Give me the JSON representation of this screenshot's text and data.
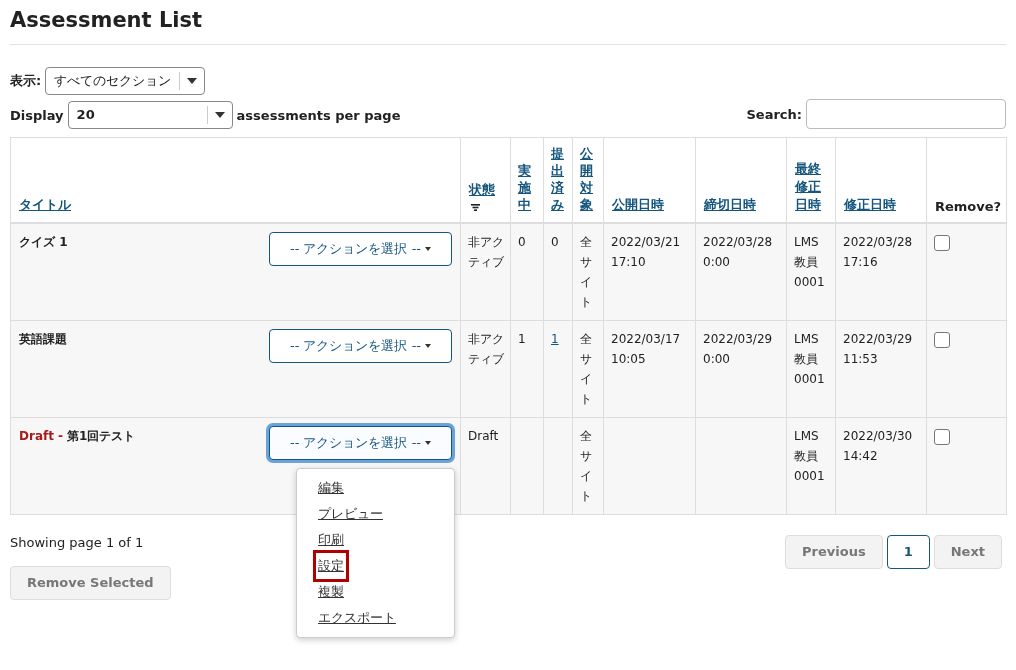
{
  "page_title": "Assessment List",
  "section_filter": {
    "label": "表示:",
    "value": "すべてのセクション"
  },
  "page_size": {
    "label": "Display",
    "value": "20",
    "suffix": "assessments per page"
  },
  "search": {
    "label": "Search:"
  },
  "table": {
    "columns": [
      {
        "label": "タイトル",
        "link": true,
        "vertical": false,
        "sort_icon": false
      },
      {
        "label": "状態",
        "link": true,
        "vertical": false,
        "sort_icon": true
      },
      {
        "label": "実施中",
        "link": true,
        "vertical": true,
        "sort_icon": false
      },
      {
        "label": "提出済み",
        "link": true,
        "vertical": true,
        "sort_icon": false
      },
      {
        "label": "公開対象",
        "link": true,
        "vertical": true,
        "sort_icon": false
      },
      {
        "label": "公開日時",
        "link": true,
        "vertical": false,
        "sort_icon": false
      },
      {
        "label": "締切日時",
        "link": true,
        "vertical": false,
        "sort_icon": false
      },
      {
        "label": "最終修正日時",
        "link": true,
        "vertical": false,
        "sort_icon": false
      },
      {
        "label": "修正日時",
        "link": true,
        "vertical": false,
        "sort_icon": false
      },
      {
        "label": "Remove?",
        "link": false,
        "vertical": false,
        "sort_icon": false
      }
    ],
    "rows": [
      {
        "title": "クイズ 1",
        "action": {
          "label": "-- アクションを選択 --",
          "focused": false,
          "expanded": false
        },
        "status": "非アクティブ",
        "in_progress": "0",
        "submitted": "0",
        "submitted_link": false,
        "audience": "全サイト",
        "release": "2022/03/21 17:10",
        "due": "2022/03/28 0:00",
        "modified_by": "LMS 教員 0001",
        "modified": "2022/03/28 17:16",
        "checked": false
      },
      {
        "title": "英語課題",
        "action": {
          "label": "-- アクションを選択 --",
          "focused": false,
          "expanded": false
        },
        "status": "非アクティブ",
        "in_progress": "1",
        "submitted": "1",
        "submitted_link": true,
        "audience": "全サイト",
        "release": "2022/03/17 10:05",
        "due": "2022/03/29 0:00",
        "modified_by": "LMS 教員 0001",
        "modified": "2022/03/29 11:53",
        "checked": false
      },
      {
        "draft_label": "Draft -",
        "title": "第1回テスト",
        "action": {
          "label": "-- アクションを選択 --",
          "focused": true,
          "expanded": true,
          "menu": [
            {
              "label": "編集",
              "highlighted": false
            },
            {
              "label": "プレビュー",
              "highlighted": false
            },
            {
              "label": "印刷",
              "highlighted": false
            },
            {
              "label": "設定",
              "highlighted": true
            },
            {
              "label": "複製",
              "highlighted": false
            },
            {
              "label": "エクスポート",
              "highlighted": false
            }
          ]
        },
        "status": "Draft",
        "audience": "全サイト",
        "modified_by": "LMS 教員 0001",
        "modified": "2022/03/30 14:42",
        "checked": false
      }
    ]
  },
  "footer": {
    "showing": "Showing page 1 of 1",
    "remove_button": "Remove Selected"
  },
  "pagination": {
    "previous": "Previous",
    "pages": [
      {
        "label": "1",
        "selected": true
      }
    ],
    "next": "Next"
  }
}
